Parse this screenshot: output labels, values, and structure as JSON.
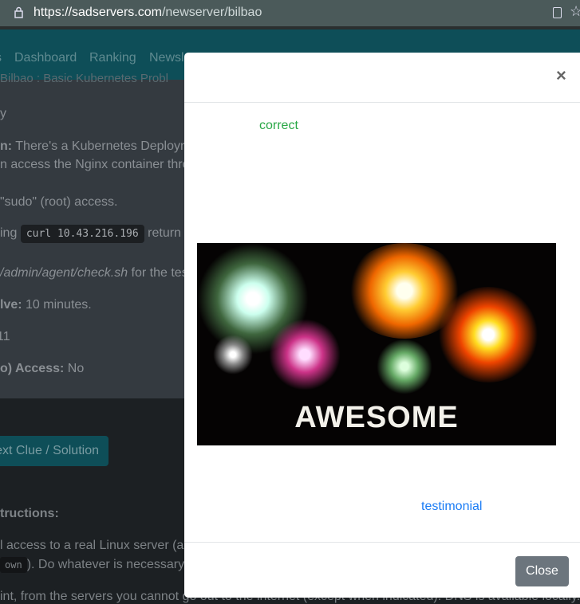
{
  "browser": {
    "url_host": "https://sadservers.com",
    "url_path": "/newserver/bilbao"
  },
  "nav": {
    "items": [
      "s",
      "Dashboard",
      "Ranking",
      "Newsl"
    ]
  },
  "breadcrumb": "Bilbao : Basic Kubernetes Probl",
  "content": {
    "lines": [
      "y",
      "n:",
      "There's a Kubernetes Deploym",
      "n access the Nginx container thro",
      "\"sudo\" (root) access.",
      "ing",
      "curl 10.43.216.196",
      "return",
      "/admin/agent/check.sh",
      "for the tes",
      "lve:",
      "10 minutes.",
      "11",
      "o) Access:",
      "No"
    ]
  },
  "lower": {
    "clue_button": "ext Clue / Solution",
    "instructions_heading": "tructions:",
    "line1": "l access to a real Linux server (ar",
    "code": "own",
    "line2": "). Do whatever is necessary",
    "line3": "int, from the servers you cannot go out to the internet (except when indicated). DNS is available locally."
  },
  "modal": {
    "close_x": "×",
    "status": "correct",
    "image_text": "AWESOME",
    "link": "testimonial",
    "close_button": "Close"
  },
  "colors": {
    "nav": "#0e4e58",
    "correct": "#28a745",
    "link": "#1a7cf5",
    "close_button": "#6c757d"
  }
}
